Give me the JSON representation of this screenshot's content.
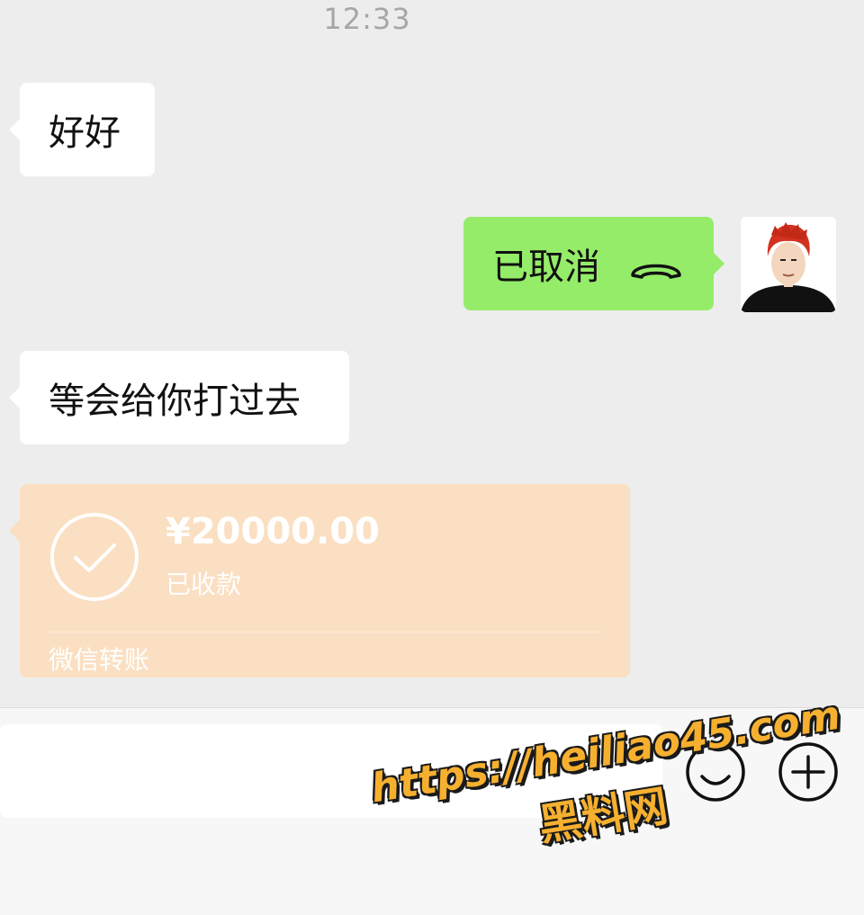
{
  "chat": {
    "timestamp": "12:33",
    "messages": [
      {
        "from": "other",
        "text": "好好"
      },
      {
        "from": "me",
        "text": "已取消",
        "icon": "phone-hangup-icon"
      },
      {
        "from": "other",
        "text": "等会给你打过去"
      }
    ],
    "transfer": {
      "amount": "¥20000.00",
      "status": "已收款",
      "source": "微信转账",
      "icon": "check-circle-icon"
    }
  },
  "input_bar": {
    "value": "",
    "emoji_icon": "emoji-icon",
    "plus_icon": "plus-icon"
  },
  "watermark": {
    "url": "https://heiliao45.com",
    "name": "黑料网"
  },
  "colors": {
    "chat_background": "#ededed",
    "sent_bubble": "#95ec69",
    "received_bubble": "#ffffff",
    "transfer_card": "#fbdfc2",
    "watermark": "#f6b02f"
  }
}
